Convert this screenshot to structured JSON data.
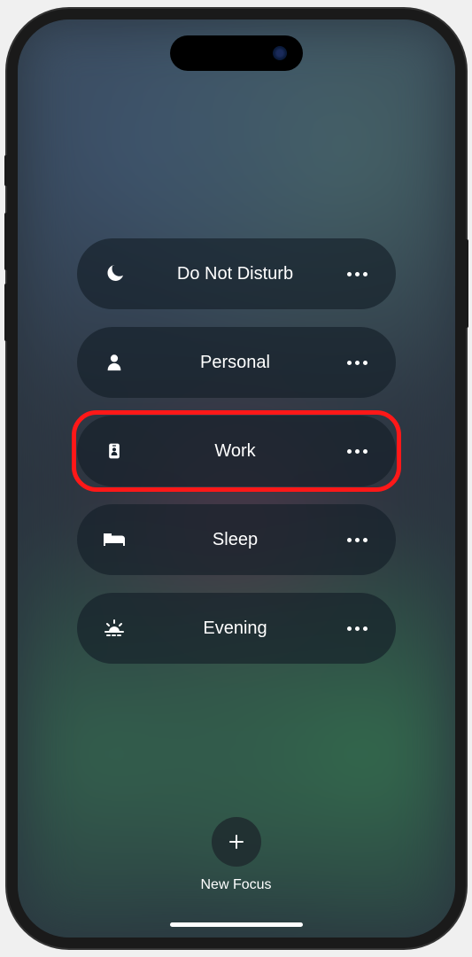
{
  "focus_modes": [
    {
      "icon": "moon",
      "label": "Do Not Disturb",
      "highlighted": false
    },
    {
      "icon": "person",
      "label": "Personal",
      "highlighted": false
    },
    {
      "icon": "badge",
      "label": "Work",
      "highlighted": true
    },
    {
      "icon": "bed",
      "label": "Sleep",
      "highlighted": false
    },
    {
      "icon": "sunset",
      "label": "Evening",
      "highlighted": false
    }
  ],
  "new_focus": {
    "label": "New Focus"
  }
}
